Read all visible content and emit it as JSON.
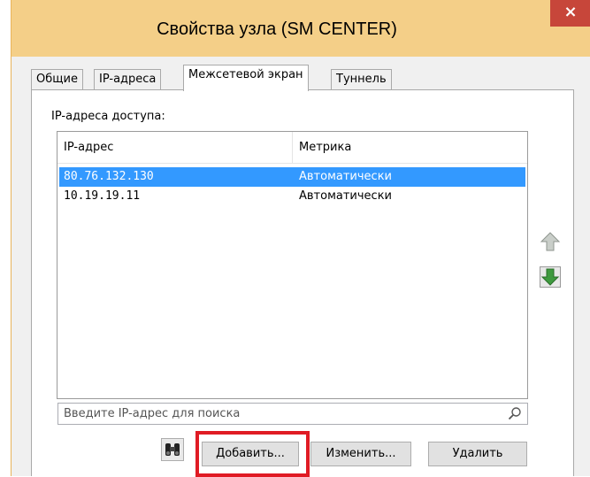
{
  "window": {
    "title": "Свойства узла (SM CENTER)",
    "close_label": "×"
  },
  "tabs": [
    {
      "label": "Общие",
      "active": false
    },
    {
      "label": "IP-адреса",
      "active": false
    },
    {
      "label": "Межсетевой экран",
      "active": true
    },
    {
      "label": "Туннель",
      "active": false
    }
  ],
  "panel": {
    "access_label": "IP-адреса доступа:",
    "columns": [
      "IP-адрес",
      "Метрика"
    ],
    "rows": [
      {
        "ip": "80.76.132.130",
        "metric": "Автоматически",
        "selected": true
      },
      {
        "ip": "10.19.19.11",
        "metric": "Автоматически",
        "selected": false
      }
    ],
    "search": {
      "value": "",
      "placeholder": "Введите IP-адрес для поиска"
    },
    "buttons": {
      "add": "Добавить...",
      "edit": "Изменить...",
      "delete": "Удалить"
    }
  },
  "icons": {
    "move_up": "arrow-up-icon",
    "move_down": "arrow-down-icon",
    "search": "magnifier-icon",
    "find": "binoculars-icon"
  },
  "colors": {
    "titlebar": "#f4cf88",
    "close": "#c7463a",
    "selection": "#3399ff",
    "highlight": "#e01b24",
    "arrow_up": "#b0b8b0",
    "arrow_down": "#3f9a3f"
  }
}
